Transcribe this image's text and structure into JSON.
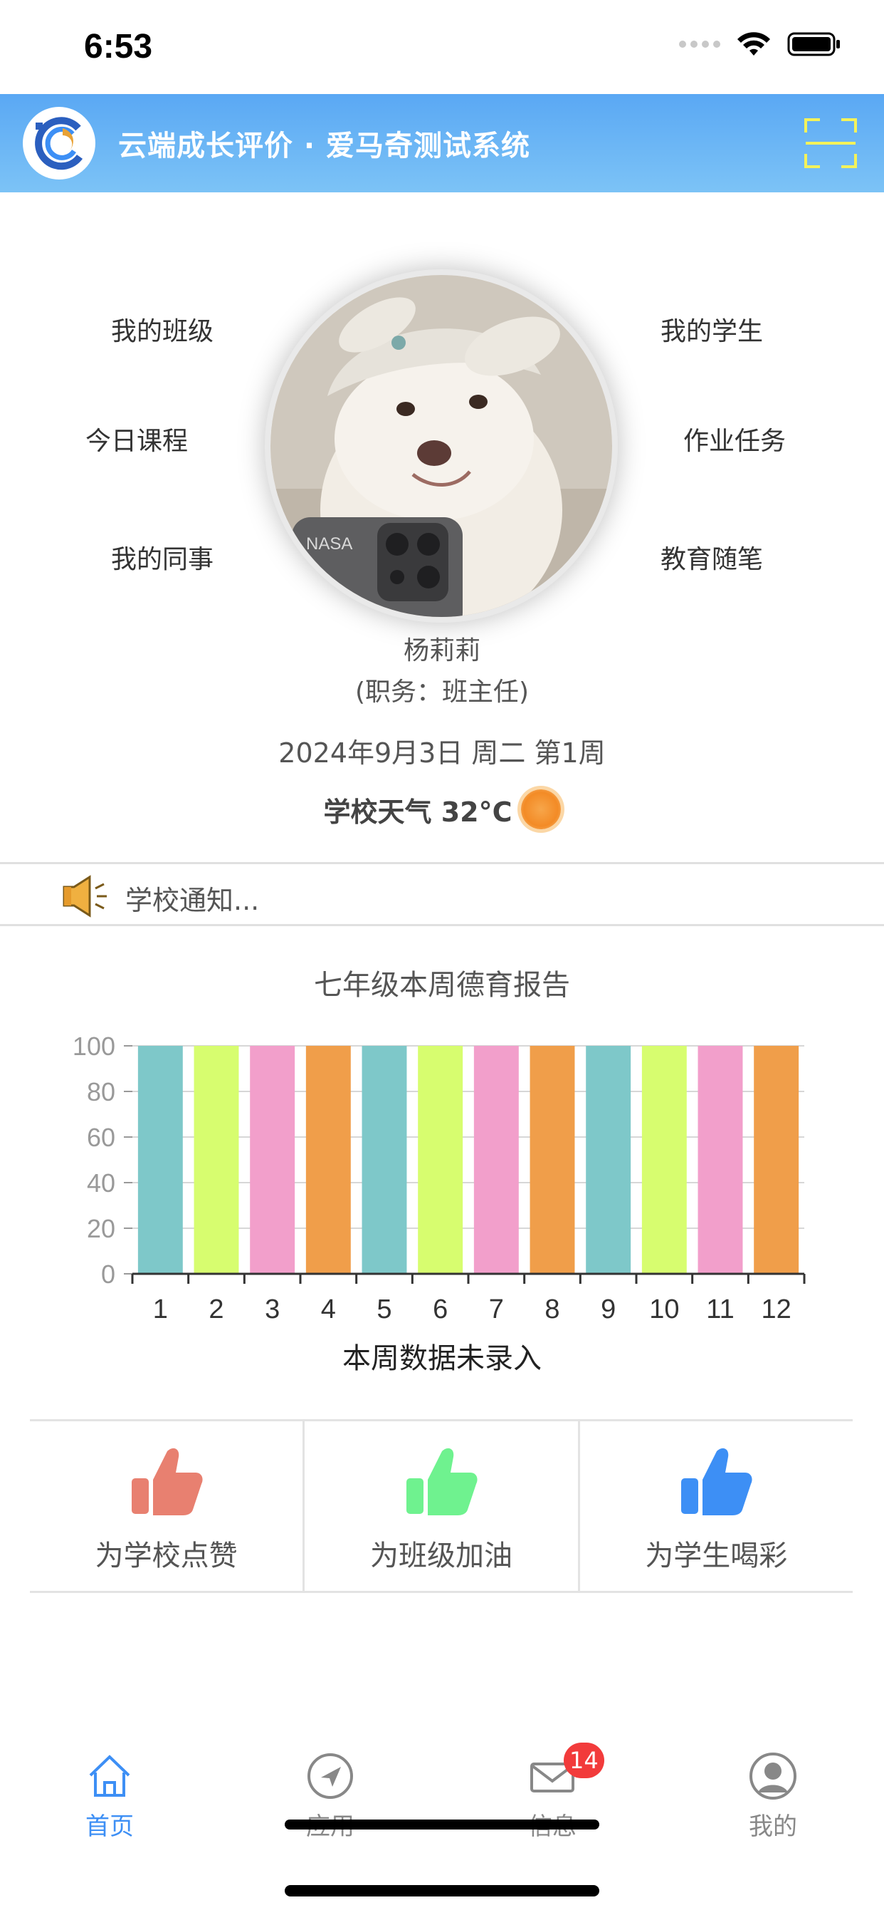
{
  "status_bar": {
    "time": "6:53"
  },
  "header": {
    "title": "云端成长评价 · 爱马奇测试系统"
  },
  "profile": {
    "menu": {
      "my_class": "我的班级",
      "my_students": "我的学生",
      "today_courses": "今日课程",
      "homework_tasks": "作业任务",
      "my_colleagues": "我的同事",
      "edu_notes": "教育随笔"
    },
    "name": "杨莉莉",
    "role": "(职务：班主任)",
    "date": "2024年9月3日 周二 第1周",
    "weather": "学校天气 32°C"
  },
  "notice": {
    "text": "学校通知..."
  },
  "chart_data": {
    "type": "bar",
    "title": "七年级本周德育报告",
    "caption": "本周数据未录入",
    "categories": [
      "1",
      "2",
      "3",
      "4",
      "5",
      "6",
      "7",
      "8",
      "9",
      "10",
      "11",
      "12"
    ],
    "values": [
      100,
      100,
      100,
      100,
      100,
      100,
      100,
      100,
      100,
      100,
      100,
      100
    ],
    "colors": [
      "#7ec8c9",
      "#d7fd6f",
      "#f29fcb",
      "#f09e4a",
      "#7ec8c9",
      "#d7fd6f",
      "#f29fcb",
      "#f09e4a",
      "#7ec8c9",
      "#d7fd6f",
      "#f29fcb",
      "#f09e4a"
    ],
    "yticks": [
      0,
      20,
      40,
      60,
      80,
      100
    ],
    "ylim": [
      0,
      100
    ],
    "grid": true
  },
  "actions": [
    {
      "label": "为学校点赞",
      "color": "#e88070"
    },
    {
      "label": "为班级加油",
      "color": "#6ff28f"
    },
    {
      "label": "为学生喝彩",
      "color": "#3d8ff5"
    }
  ],
  "tabs": [
    {
      "label": "首页",
      "icon": "home-icon",
      "active": true
    },
    {
      "label": "应用",
      "icon": "compass-icon",
      "active": false
    },
    {
      "label": "信息",
      "icon": "mail-icon",
      "active": false,
      "badge": "14"
    },
    {
      "label": "我的",
      "icon": "user-icon",
      "active": false
    }
  ],
  "colors": {
    "accent": "#3d8ff5",
    "header_start": "#5aa8f4",
    "header_end": "#7cc3f6"
  }
}
